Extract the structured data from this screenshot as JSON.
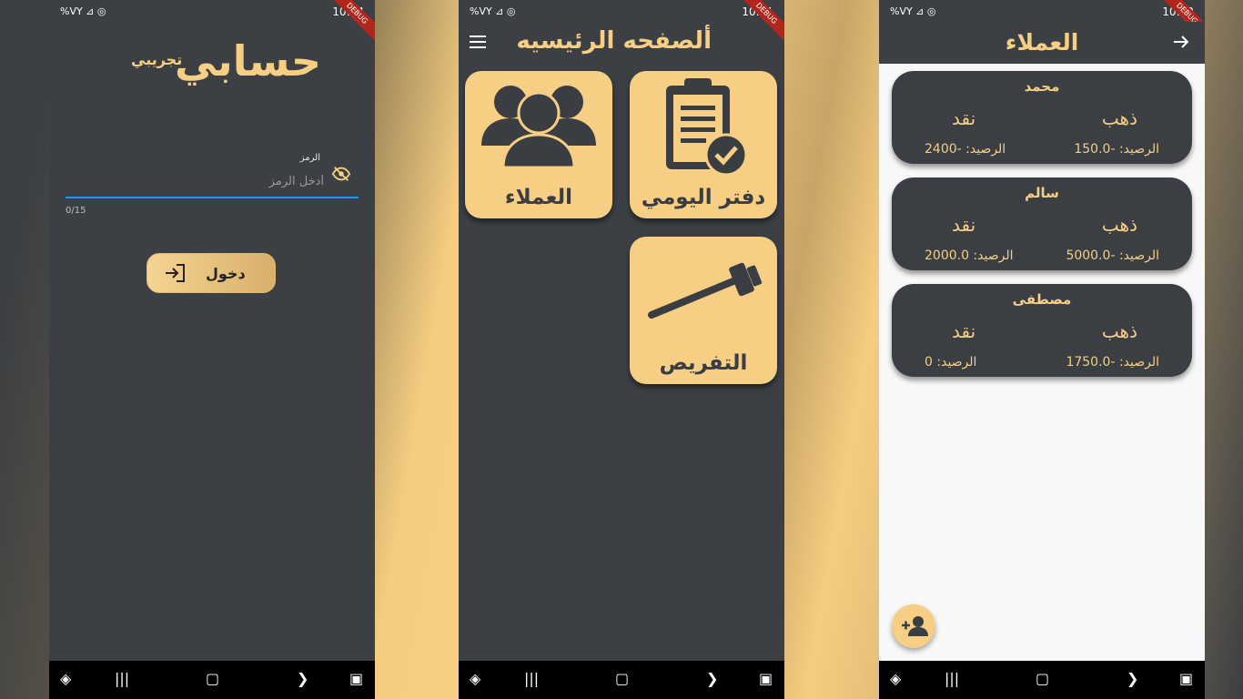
{
  "status_bars": [
    {
      "left": "%VY ⊿ ◎",
      "time": "10:44"
    },
    {
      "left": "%VY ⊿ ◎",
      "time": "10:41"
    },
    {
      "left": "%VY ⊿ ◎",
      "time": "10:42"
    }
  ],
  "debug_banner": "DEBUG",
  "login": {
    "logo_main": "حسابي",
    "logo_sub": "تجريبي",
    "field_label": "الرمز",
    "field_placeholder": "أدخل الرمز",
    "counter": "0/15",
    "button_label": "دخول"
  },
  "home": {
    "title": "ألصفحه الرئيسيه",
    "tiles": [
      {
        "label": "العملاء",
        "icon": "customers-icon"
      },
      {
        "label": "دفتر اليومي",
        "icon": "clipboard-check-icon"
      },
      {
        "label": "التفريص",
        "icon": "tool-icon"
      }
    ]
  },
  "customers": {
    "title": "العملاء",
    "cards": [
      {
        "name": "محمد",
        "gold_label": "ذهب",
        "cash_label": "نقد",
        "gold_balance": "الرصيد: -150.0",
        "cash_balance": "الرصيد: -2400"
      },
      {
        "name": "سالم",
        "gold_label": "ذهب",
        "cash_label": "نقد",
        "gold_balance": "الرصيد: -5000.0",
        "cash_balance": "الرصيد: 2000.0"
      },
      {
        "name": "مصطفى",
        "gold_label": "ذهب",
        "cash_label": "نقد",
        "gold_balance": "الرصيد: -1750.0",
        "cash_balance": "الرصيد: 0"
      }
    ]
  },
  "colors": {
    "accent": "#f6cf84",
    "panel": "#3c3f44",
    "input_focus": "#2196f3"
  }
}
